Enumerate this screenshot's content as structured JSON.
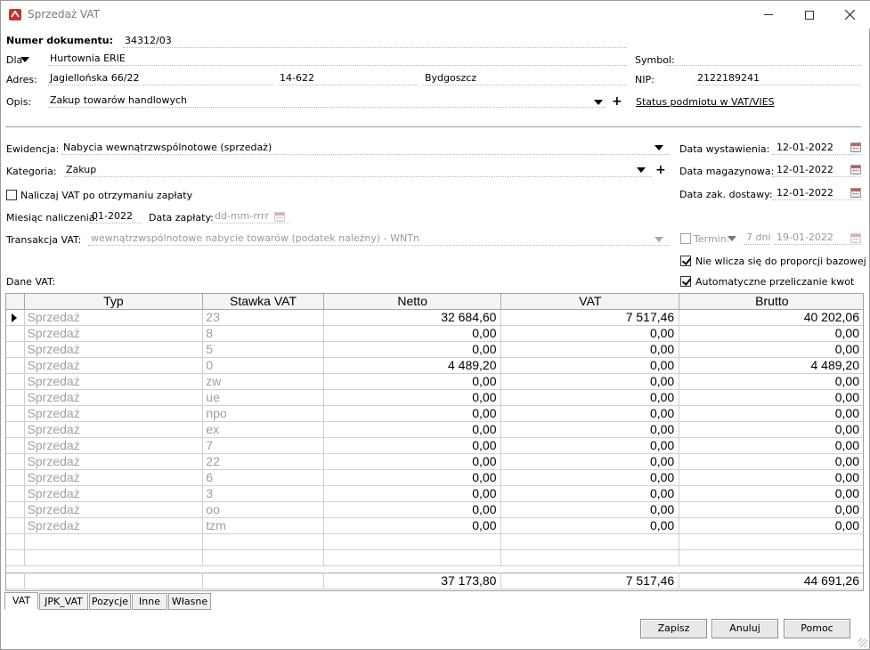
{
  "window": {
    "title": "Sprzedaż VAT",
    "min_icon": "minimize-icon",
    "max_icon": "maximize-icon",
    "close_icon": "close-icon"
  },
  "header": {
    "doc_number_label": "Numer dokumentu:",
    "doc_number": "34312/03",
    "dla_label": "Dla",
    "customer": "Hurtownia ERIE",
    "symbol_label": "Symbol:",
    "symbol": "",
    "address_label": "Adres:",
    "street": "Jagiellońska  66/22",
    "postcode": "14-622",
    "city": "Bydgoszcz",
    "nip_label": "NIP:",
    "nip": "2122189241",
    "desc_label": "Opis:",
    "desc": "Zakup towarów handlowych",
    "vies_link": "Status podmiotu w VAT/VIES"
  },
  "details": {
    "ewidencja_label": "Ewidencja:",
    "ewidencja": "Nabycia wewnątrzwspólnotowe (sprzedaż)",
    "kategoria_label": "Kategoria:",
    "kategoria": "Zakup",
    "naliczaj_label": "Naliczaj VAT po otrzymaniu zapłaty",
    "naliczaj_checked": false,
    "miesiac_label": "Miesiąc naliczenia:",
    "miesiac": "01-2022",
    "data_zaplaty_label": "Data zapłaty:",
    "data_zaplaty_placeholder": "dd-mm-rrrr",
    "transakcja_label": "Transakcja VAT:",
    "transakcja": "wewnątrzwspólnotowe nabycie towarów (podatek należny) - WNTn",
    "dane_vat_label": "Dane VAT:",
    "data_wyst_label": "Data wystawienia:",
    "data_wyst": "12-01-2022",
    "data_mag_label": "Data magazynowa:",
    "data_mag": "12-01-2022",
    "data_dost_label": "Data zak. dostawy:",
    "data_dost": "12-01-2022",
    "termin_label": "Termin:",
    "termin_dni": "7 dni",
    "termin_date": "19-01-2022",
    "nie_wlicza_label": "Nie wlicza się do proporcji bazowej",
    "nie_wlicza_checked": true,
    "auto_label": "Automatyczne przeliczanie kwot",
    "auto_checked": true
  },
  "grid": {
    "columns": [
      "Typ",
      "Stawka VAT",
      "Netto",
      "VAT",
      "Brutto"
    ],
    "rows": [
      {
        "typ": "Sprzedaż",
        "stawka": "23",
        "netto": "32 684,60",
        "vat": "7 517,46",
        "brutto": "40 202,06"
      },
      {
        "typ": "Sprzedaż",
        "stawka": "8",
        "netto": "0,00",
        "vat": "0,00",
        "brutto": "0,00"
      },
      {
        "typ": "Sprzedaż",
        "stawka": "5",
        "netto": "0,00",
        "vat": "0,00",
        "brutto": "0,00"
      },
      {
        "typ": "Sprzedaż",
        "stawka": "0",
        "netto": "4 489,20",
        "vat": "0,00",
        "brutto": "4 489,20"
      },
      {
        "typ": "Sprzedaż",
        "stawka": "zw",
        "netto": "0,00",
        "vat": "0,00",
        "brutto": "0,00"
      },
      {
        "typ": "Sprzedaż",
        "stawka": "ue",
        "netto": "0,00",
        "vat": "0,00",
        "brutto": "0,00"
      },
      {
        "typ": "Sprzedaż",
        "stawka": "npo",
        "netto": "0,00",
        "vat": "0,00",
        "brutto": "0,00"
      },
      {
        "typ": "Sprzedaż",
        "stawka": "ex",
        "netto": "0,00",
        "vat": "0,00",
        "brutto": "0,00"
      },
      {
        "typ": "Sprzedaż",
        "stawka": "7",
        "netto": "0,00",
        "vat": "0,00",
        "brutto": "0,00"
      },
      {
        "typ": "Sprzedaż",
        "stawka": "22",
        "netto": "0,00",
        "vat": "0,00",
        "brutto": "0,00"
      },
      {
        "typ": "Sprzedaż",
        "stawka": "6",
        "netto": "0,00",
        "vat": "0,00",
        "brutto": "0,00"
      },
      {
        "typ": "Sprzedaż",
        "stawka": "3",
        "netto": "0,00",
        "vat": "0,00",
        "brutto": "0,00"
      },
      {
        "typ": "Sprzedaż",
        "stawka": "oo",
        "netto": "0,00",
        "vat": "0,00",
        "brutto": "0,00"
      },
      {
        "typ": "Sprzedaż",
        "stawka": "tzm",
        "netto": "0,00",
        "vat": "0,00",
        "brutto": "0,00"
      }
    ],
    "totals": {
      "netto": "37 173,80",
      "vat": "7 517,46",
      "brutto": "44 691,26"
    }
  },
  "tabs": [
    "VAT",
    "JPK_VAT",
    "Pozycje",
    "Inne",
    "Własne"
  ],
  "buttons": {
    "save": "Zapisz",
    "cancel": "Anuluj",
    "help": "Pomoc"
  }
}
